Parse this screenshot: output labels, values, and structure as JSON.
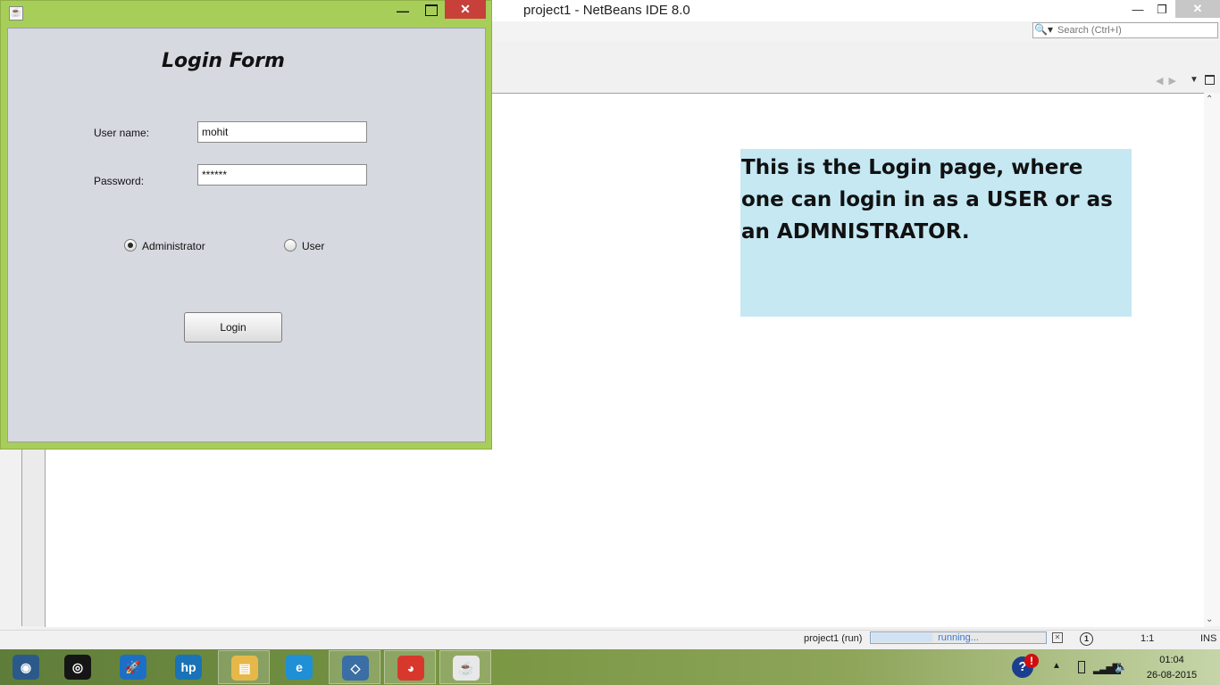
{
  "netbeans": {
    "title": "project1 - NetBeans IDE 8.0",
    "minimize": "—",
    "maximize": "❐",
    "close": "✕",
    "search_placeholder": "Search (Ctrl+I)",
    "search_icon": "magnifier-icon",
    "status": {
      "project": "project1 (run)",
      "progress_text": "running...",
      "progress_fraction": 0.35,
      "notification_count": "1",
      "position": "1:1",
      "mode": "INS"
    }
  },
  "annotation": {
    "text": "This is the Login page, where one can login in as a USER or as an ADMNISTRATOR."
  },
  "login_form": {
    "window_close": "✕",
    "window_min": "—",
    "title": "Login Form",
    "username_label": "User name:",
    "username_value": "mohit",
    "password_label": "Password:",
    "password_value": "******",
    "role_admin_label": "Administrator",
    "role_user_label": "User",
    "selected_role": "Administrator",
    "login_button": "Login"
  },
  "taskbar": {
    "items": [
      {
        "icon": "start-orb-icon",
        "glyph": "◉",
        "color": "#2b5a8a"
      },
      {
        "icon": "webcam-icon",
        "glyph": "◎",
        "color": "#151515"
      },
      {
        "icon": "rocket-icon",
        "glyph": "🚀",
        "color": "#1c6fc4"
      },
      {
        "icon": "hp-icon",
        "glyph": "hp",
        "color": "#1a73b8"
      },
      {
        "icon": "file-explorer-icon",
        "glyph": "▤",
        "color": "#e6b84a"
      },
      {
        "icon": "internet-explorer-icon",
        "glyph": "e",
        "color": "#1f8fd6"
      },
      {
        "icon": "virtualbox-icon",
        "glyph": "◇",
        "color": "#3a6ea5"
      },
      {
        "icon": "chrome-icon",
        "glyph": "◕",
        "color": "#d8382c"
      },
      {
        "icon": "java-icon",
        "glyph": "☕",
        "color": "#e8e8e8"
      }
    ],
    "tray": {
      "help": "?",
      "alert": "!",
      "time": "01:04",
      "date": "26-08-2015"
    }
  }
}
